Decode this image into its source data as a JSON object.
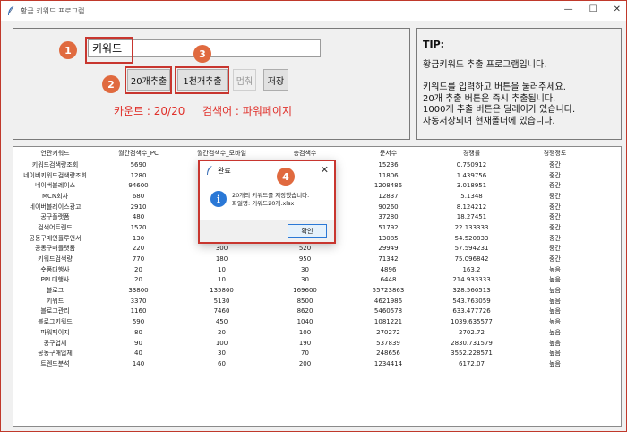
{
  "window": {
    "title": "황금 키워드 프로그램",
    "controls": [
      "—",
      "☐",
      "✕"
    ]
  },
  "input": {
    "keyword_value": "키워드"
  },
  "buttons": {
    "extract20": "20개추출",
    "extract1000": "1천개추출",
    "stop": "멈춰",
    "save": "저장"
  },
  "markers": [
    "1",
    "2",
    "3",
    "4"
  ],
  "status": {
    "count": "카운트 : 20/20",
    "search": "검색어 : 파워페이지"
  },
  "tip": {
    "title": "TIP:",
    "lines": [
      "황금키워드 추출 프로그램입니다.",
      "",
      "키워드를 입력하고 버튼을 눌러주세요.",
      "20개 추출 버튼은 즉시 추출됩니다.",
      "1000개 추출 버튼은 딜레이가 있습니다.",
      "자동저장되며 현재폴더에 있습니다."
    ]
  },
  "table": {
    "headers": [
      "연관키워드",
      "월간검색수_PC",
      "월간검색수_모바일",
      "총검색수",
      "문서수",
      "경쟁률",
      "경쟁정도"
    ],
    "rows": [
      [
        "키워드검색량조회",
        "5690",
        "",
        "",
        "15236",
        "0.750912",
        "중간"
      ],
      [
        "네이버키워드검색량조회",
        "1280",
        "",
        "",
        "11806",
        "1.439756",
        "중간"
      ],
      [
        "네이버블레이스",
        "94600",
        "",
        "",
        "1208486",
        "3.018951",
        "중간"
      ],
      [
        "MCN회사",
        "680",
        "",
        "",
        "12837",
        "5.1348",
        "중간"
      ],
      [
        "네이버블레이스광고",
        "2910",
        "",
        "",
        "90260",
        "8.124212",
        "중간"
      ],
      [
        "공구플랫폼",
        "480",
        "",
        "",
        "37280",
        "18.27451",
        "중간"
      ],
      [
        "검색어트렌드",
        "1520",
        "",
        "",
        "51792",
        "22.133333",
        "중간"
      ],
      [
        "공동구매인플루언서",
        "130",
        "",
        "",
        "13085",
        "54.520833",
        "중간"
      ],
      [
        "공동구매플랫폼",
        "220",
        "300",
        "520",
        "29949",
        "57.594231",
        "중간"
      ],
      [
        "키워드검색량",
        "770",
        "180",
        "950",
        "71342",
        "75.096842",
        "중간"
      ],
      [
        "숏폼대행사",
        "20",
        "10",
        "30",
        "4896",
        "163.2",
        "높음"
      ],
      [
        "PPL대행사",
        "20",
        "10",
        "30",
        "6448",
        "214.933333",
        "높음"
      ],
      [
        "블로그",
        "33800",
        "135800",
        "169600",
        "55723863",
        "328.560513",
        "높음"
      ],
      [
        "키워드",
        "3370",
        "5130",
        "8500",
        "4621986",
        "543.763059",
        "높음"
      ],
      [
        "블로그관리",
        "1160",
        "7460",
        "8620",
        "5460578",
        "633.477726",
        "높음"
      ],
      [
        "블로그키워드",
        "590",
        "450",
        "1040",
        "1081221",
        "1039.635577",
        "높음"
      ],
      [
        "파워페이지",
        "80",
        "20",
        "100",
        "270272",
        "2702.72",
        "높음"
      ],
      [
        "공구업체",
        "90",
        "100",
        "190",
        "537839",
        "2830.731579",
        "높음"
      ],
      [
        "공동구매업체",
        "40",
        "30",
        "70",
        "248656",
        "3552.228571",
        "높음"
      ],
      [
        "트렌드분석",
        "140",
        "60",
        "200",
        "1234414",
        "6172.07",
        "높음"
      ]
    ]
  },
  "dialog": {
    "title": "완료",
    "close": "✕",
    "message_line1": "20개의 키워드를 저장했습니다.",
    "message_line2": "파일명: 키워드20개.xlsx",
    "ok": "확인",
    "info_glyph": "i"
  },
  "colors": {
    "highlight": "#c8362f",
    "marker": "#e06a3f",
    "status_text": "#e0302a",
    "info_icon": "#2a78d6"
  },
  "icons": [
    "feather-icon",
    "info-icon",
    "close-icon"
  ]
}
